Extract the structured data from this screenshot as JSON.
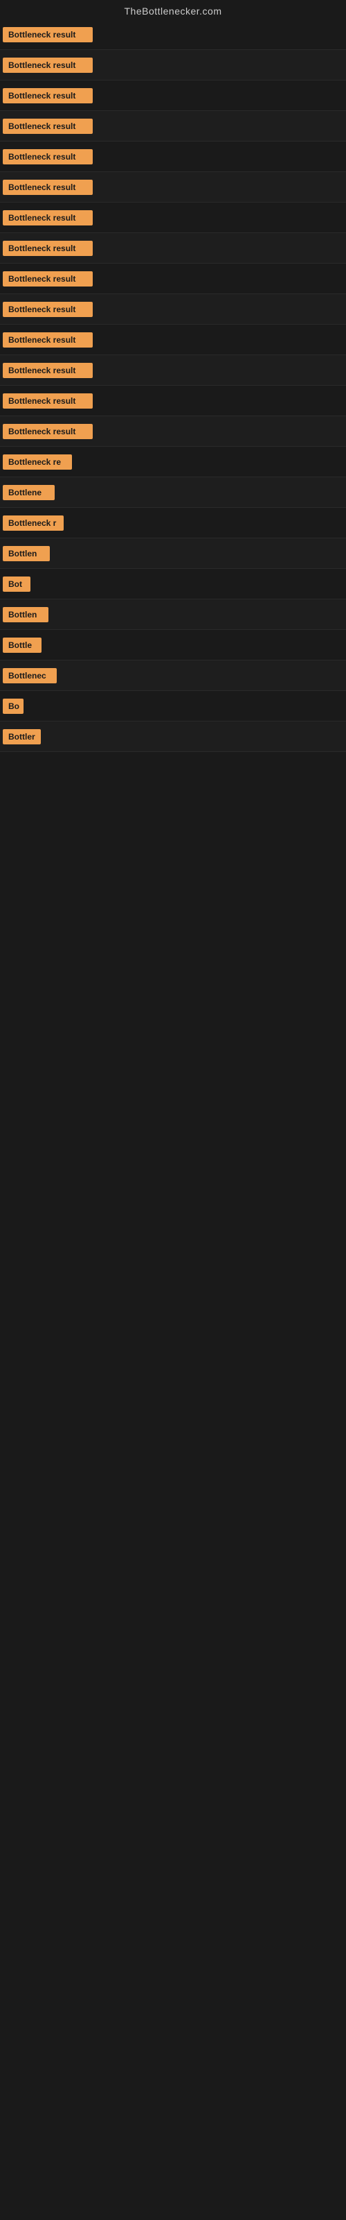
{
  "header": {
    "title": "TheBottlenecker.com"
  },
  "results": [
    {
      "id": 1,
      "label": "Bottleneck result",
      "width": 130
    },
    {
      "id": 2,
      "label": "Bottleneck result",
      "width": 130
    },
    {
      "id": 3,
      "label": "Bottleneck result",
      "width": 130
    },
    {
      "id": 4,
      "label": "Bottleneck result",
      "width": 130
    },
    {
      "id": 5,
      "label": "Bottleneck result",
      "width": 130
    },
    {
      "id": 6,
      "label": "Bottleneck result",
      "width": 130
    },
    {
      "id": 7,
      "label": "Bottleneck result",
      "width": 130
    },
    {
      "id": 8,
      "label": "Bottleneck result",
      "width": 130
    },
    {
      "id": 9,
      "label": "Bottleneck result",
      "width": 130
    },
    {
      "id": 10,
      "label": "Bottleneck result",
      "width": 130
    },
    {
      "id": 11,
      "label": "Bottleneck result",
      "width": 130
    },
    {
      "id": 12,
      "label": "Bottleneck result",
      "width": 130
    },
    {
      "id": 13,
      "label": "Bottleneck result",
      "width": 130
    },
    {
      "id": 14,
      "label": "Bottleneck result",
      "width": 130
    },
    {
      "id": 15,
      "label": "Bottleneck re",
      "width": 100
    },
    {
      "id": 16,
      "label": "Bottlene",
      "width": 75
    },
    {
      "id": 17,
      "label": "Bottleneck r",
      "width": 88
    },
    {
      "id": 18,
      "label": "Bottlen",
      "width": 68
    },
    {
      "id": 19,
      "label": "Bot",
      "width": 40
    },
    {
      "id": 20,
      "label": "Bottlen",
      "width": 66
    },
    {
      "id": 21,
      "label": "Bottle",
      "width": 56
    },
    {
      "id": 22,
      "label": "Bottlenec",
      "width": 78
    },
    {
      "id": 23,
      "label": "Bo",
      "width": 30
    },
    {
      "id": 24,
      "label": "Bottler",
      "width": 55
    }
  ]
}
